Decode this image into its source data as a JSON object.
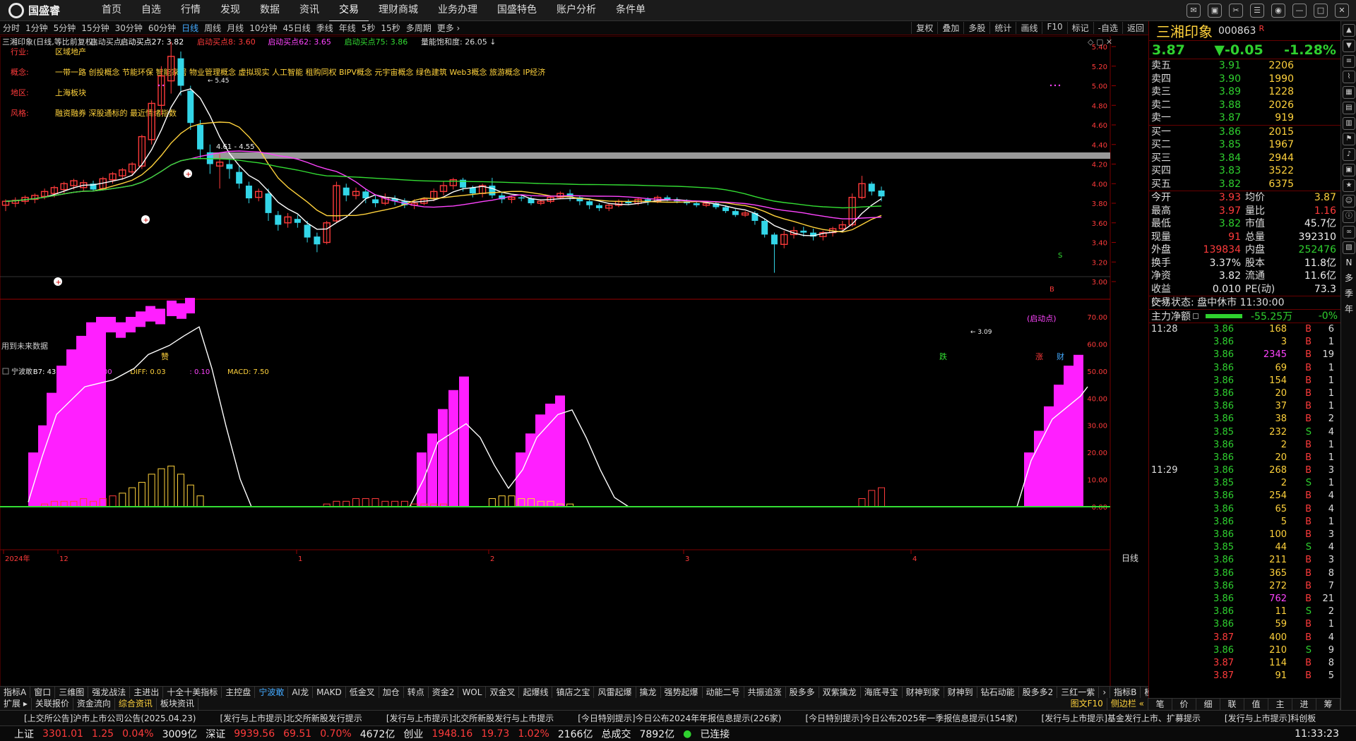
{
  "app": {
    "logo_text": "国盛睿"
  },
  "top_menu": [
    "首页",
    "自选",
    "行情",
    "发现",
    "数据",
    "资讯",
    "交易",
    "理财商城",
    "业务办理",
    "国盛特色",
    "账户分析",
    "条件单"
  ],
  "window_controls": [
    "消息",
    "邮件",
    "工具",
    "设置",
    "皮肤",
    "最小化",
    "最大化",
    "关闭"
  ],
  "period_bar": {
    "periods": [
      "分时",
      "1分钟",
      "5分钟",
      "15分钟",
      "30分钟",
      "60分钟",
      "日线",
      "周线",
      "月线",
      "10分钟",
      "45日线",
      "季线",
      "年线",
      "5秒",
      "15秒",
      "多周期",
      "更多 ›"
    ],
    "active": "日线",
    "tools": [
      "复权",
      "叠加",
      "多股",
      "统计",
      "画线",
      "F10",
      "标记",
      "-自选",
      "返回"
    ]
  },
  "main_chart": {
    "legend": [
      {
        "text": "三湘印象(日线,等比前复权)",
        "color": "#dddddd"
      },
      {
        "text": "启动买点",
        "color": "#dddddd"
      },
      {
        "text": "启动买点27: 3.82",
        "color": "#ffffff"
      },
      {
        "text": "启动买点8: 3.60",
        "color": "#ff3b3b"
      },
      {
        "text": "启动买点62: 3.65",
        "color": "#ff44ff"
      },
      {
        "text": "启动买点75: 3.86",
        "color": "#33dd33"
      },
      {
        "text": "量能饱和度: 26.05 ↓",
        "color": "#dddddd"
      }
    ],
    "info": [
      {
        "label": "行业:",
        "value": "区域地产"
      },
      {
        "label": "概念:",
        "value": "一带一路 创投概念 节能环保 智能家居 物业管理概念 虚拟现实 人工智能 租购同权 BIPV概念 元宇宙概念 绿色建筑 Web3概念 旅游概念 IP经济"
      },
      {
        "label": "地区:",
        "value": "上海板块"
      },
      {
        "label": "风格:",
        "value": "融资融券 深股通标的 最近情绪指数"
      }
    ],
    "y_labels": [
      "5.40",
      "5.20",
      "5.00",
      "4.80",
      "4.60",
      "4.40",
      "4.20",
      "4.00",
      "3.80",
      "3.60",
      "3.40",
      "3.20",
      "3.00"
    ],
    "annotations": {
      "high": "5.45",
      "low": "3.09",
      "range": "4.61 - 4.55",
      "qidong": "(启动点)",
      "s_mark": "S",
      "b_mark": "B",
      "future": "用到未来数据"
    },
    "markers": {
      "m1": "赞",
      "m2": "跌",
      "m3": "涨",
      "m4": "财"
    }
  },
  "sub_chart": {
    "legend": [
      {
        "text": "宁波敢",
        "color": "#dddddd"
      },
      {
        "text": "B7: 43.62",
        "color": "#ffffff"
      },
      {
        "text": "A: 0.00",
        "color": "#ff44ff"
      },
      {
        "text": "DIFF: 0.03",
        "color": "#ffd23c"
      },
      {
        "text": ": 0.10",
        "color": "#ff44ff"
      },
      {
        "text": "MACD: 7.50",
        "color": "#ffd23c"
      }
    ],
    "y_labels": [
      "70.00",
      "60.00",
      "50.00",
      "40.00",
      "30.00",
      "20.00",
      "10.00",
      "0.00"
    ]
  },
  "chart_data": {
    "type": "candlestick",
    "x_axis_labels": [
      "2024年",
      "12",
      "1",
      "2",
      "3",
      "4"
    ],
    "period_label": "日线",
    "price_range": [
      3.0,
      5.45
    ],
    "indicator_range": [
      0,
      75
    ]
  },
  "bottom_tabs": [
    "指标A",
    "窗口",
    "三维图",
    "强龙战法",
    "主进出",
    "十全十美指标",
    "主控盘",
    "宁波敢",
    "AI龙",
    "MAKD",
    "低金叉",
    "加仓",
    "转点",
    "资金2",
    "WOL",
    "双金叉",
    "起爆线",
    "镇店之宝",
    "风雷起爆",
    "擒龙",
    "强势起爆",
    "动能二号",
    "共振追涨",
    "股多多",
    "双紫擒龙",
    "海底寻宝",
    "财神到家",
    "财神到",
    "钻石动能",
    "股多多2",
    "三红一紫",
    "›",
    "指标B",
    "模",
    "板"
  ],
  "bottom_tabs_active": "宁波敢",
  "bottom_tabs2": [
    "扩展 ▸",
    "关联报价",
    "资金流向",
    "综合资讯",
    "板块资讯"
  ],
  "bottom_tabs2_active": "综合资讯",
  "bottom_right": [
    "图文F10",
    "侧边栏 «"
  ],
  "news": [
    "[上交所公告]沪市上市公司公告(2025.04.23)",
    "[发行与上市提示]北交所新股发行提示",
    "[发行与上市提示]北交所新股发行与上市提示",
    "[今日特别提示]今日公布2024年年报信息提示(226家)",
    "[今日特别提示]今日公布2025年一季报信息提示(154家)",
    "[发行与上市提示]基金发行上市、扩募提示",
    "[发行与上市提示]科创板"
  ],
  "status": {
    "sh_label": "上证",
    "sh_val": "3301.01",
    "sh_chg": "1.25",
    "sh_pct": "0.04%",
    "sh_amt": "3009亿",
    "sz_label": "深证",
    "sz_val": "9939.56",
    "sz_chg": "69.51",
    "sz_pct": "0.70%",
    "sz_amt": "4672亿",
    "cy_label": "创业",
    "cy_val": "1948.16",
    "cy_chg": "19.73",
    "cy_pct": "1.02%",
    "cy_amt": "2166亿",
    "total_label": "总成交",
    "total": "7892亿",
    "conn": "已连接",
    "time": "11:33:23"
  },
  "quote": {
    "name": "三湘印象",
    "code": "000863",
    "flag": "R",
    "price": "3.87",
    "change": "▼-0.05",
    "pct": "-1.28%",
    "sell": [
      {
        "label": "卖五",
        "price": "3.91",
        "vol": "2206"
      },
      {
        "label": "卖四",
        "price": "3.90",
        "vol": "1990"
      },
      {
        "label": "卖三",
        "price": "3.89",
        "vol": "1228"
      },
      {
        "label": "卖二",
        "price": "3.88",
        "vol": "2026"
      },
      {
        "label": "卖一",
        "price": "3.87",
        "vol": "919"
      }
    ],
    "buy": [
      {
        "label": "买一",
        "price": "3.86",
        "vol": "2015"
      },
      {
        "label": "买二",
        "price": "3.85",
        "vol": "1967"
      },
      {
        "label": "买三",
        "price": "3.84",
        "vol": "2944"
      },
      {
        "label": "买四",
        "price": "3.83",
        "vol": "3522"
      },
      {
        "label": "买五",
        "price": "3.82",
        "vol": "6375"
      }
    ],
    "stats": [
      {
        "k": "今开",
        "v": "3.93",
        "vc": "red",
        "k2": "均价",
        "v2": "3.87",
        "v2c": "yellow"
      },
      {
        "k": "最高",
        "v": "3.97",
        "vc": "red",
        "k2": "量比",
        "v2": "1.16",
        "v2c": "red"
      },
      {
        "k": "最低",
        "v": "3.82",
        "vc": "green",
        "k2": "市值",
        "v2": "45.7亿",
        "v2c": "white"
      },
      {
        "k": "现量",
        "v": "91",
        "vc": "red",
        "k2": "总量",
        "v2": "392310",
        "v2c": "white"
      },
      {
        "k": "外盘",
        "v": "139834",
        "vc": "red",
        "k2": "内盘",
        "v2": "252476",
        "v2c": "green"
      },
      {
        "k": "换手",
        "v": "3.37%",
        "vc": "white",
        "k2": "股本",
        "v2": "11.8亿",
        "v2c": "white"
      },
      {
        "k": "净资",
        "v": "3.82",
        "vc": "white",
        "k2": "流通",
        "v2": "11.6亿",
        "v2c": "white"
      },
      {
        "k": "收益(一)",
        "v": "0.010",
        "vc": "white",
        "k2": "PE(动)",
        "v2": "73.3",
        "v2c": "white"
      }
    ],
    "trade_status": "交易状态: 盘中休市 11:30:00",
    "main_net_label": "主力净额",
    "main_net": "-55.25万",
    "main_net_pct": "-0%",
    "ticks_a_time": "11:28",
    "ticks_a": [
      [
        "3.86",
        "168",
        "B",
        "6"
      ],
      [
        "3.86",
        "3",
        "B",
        "1"
      ],
      [
        "3.86",
        "2345",
        "B",
        "19"
      ],
      [
        "3.86",
        "69",
        "B",
        "1"
      ],
      [
        "3.86",
        "154",
        "B",
        "1"
      ],
      [
        "3.86",
        "20",
        "B",
        "1"
      ],
      [
        "3.86",
        "37",
        "B",
        "1"
      ],
      [
        "3.86",
        "38",
        "B",
        "2"
      ],
      [
        "3.85",
        "232",
        "S",
        "4"
      ],
      [
        "3.86",
        "2",
        "B",
        "1"
      ],
      [
        "3.86",
        "20",
        "B",
        "1"
      ]
    ],
    "ticks_b_time": "11:29",
    "ticks_b": [
      [
        "3.86",
        "268",
        "B",
        "3"
      ],
      [
        "3.85",
        "2",
        "S",
        "1"
      ],
      [
        "3.86",
        "254",
        "B",
        "4"
      ],
      [
        "3.86",
        "65",
        "B",
        "4"
      ],
      [
        "3.86",
        "5",
        "B",
        "1"
      ],
      [
        "3.86",
        "100",
        "B",
        "3"
      ],
      [
        "3.85",
        "44",
        "S",
        "4"
      ],
      [
        "3.86",
        "211",
        "B",
        "3"
      ],
      [
        "3.86",
        "365",
        "B",
        "8"
      ],
      [
        "3.86",
        "272",
        "B",
        "7"
      ],
      [
        "3.86",
        "762",
        "B",
        "21"
      ],
      [
        "3.86",
        "11",
        "S",
        "2"
      ],
      [
        "3.86",
        "59",
        "B",
        "1"
      ],
      [
        "3.87",
        "400",
        "B",
        "4"
      ],
      [
        "3.86",
        "210",
        "S",
        "9"
      ],
      [
        "3.87",
        "114",
        "B",
        "8"
      ],
      [
        "3.87",
        "91",
        "B",
        "5"
      ]
    ]
  },
  "right_side": [
    "N",
    "多",
    "季",
    "年"
  ],
  "right_bottom_tabs": [
    "笔",
    "价",
    "细",
    "联",
    "值",
    "主",
    "进",
    "筹"
  ]
}
